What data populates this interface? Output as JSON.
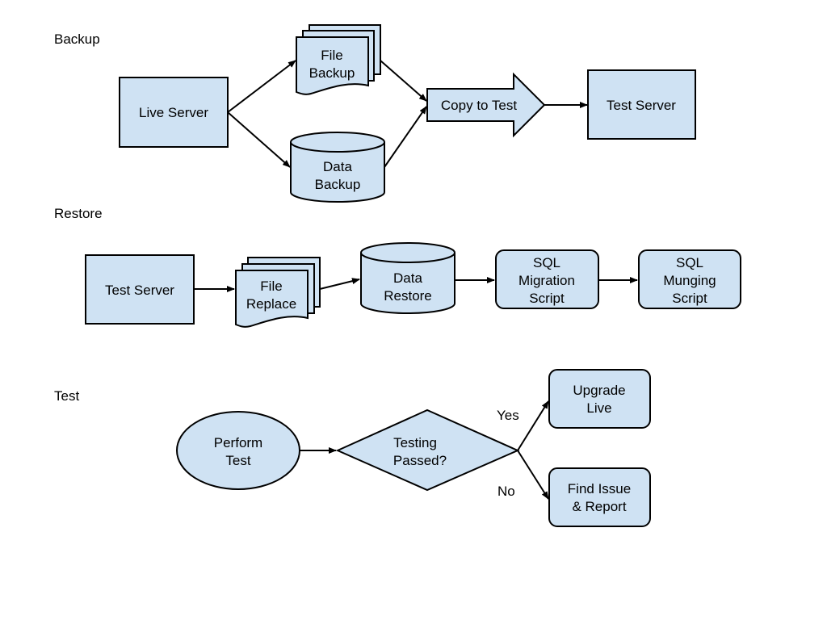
{
  "colors": {
    "fill": "#cfe2f3",
    "stroke": "#000000"
  },
  "sections": {
    "backup": "Backup",
    "restore": "Restore",
    "test": "Test"
  },
  "backup": {
    "live_server": "Live Server",
    "file_backup": [
      "File",
      "Backup"
    ],
    "data_backup": [
      "Data",
      "Backup"
    ],
    "copy_to_test": "Copy to Test",
    "test_server": "Test Server"
  },
  "restore": {
    "test_server": "Test Server",
    "file_replace": [
      "File",
      "Replace"
    ],
    "data_restore": [
      "Data",
      "Restore"
    ],
    "sql_migration": [
      "SQL",
      "Migration",
      "Script"
    ],
    "sql_munging": [
      "SQL",
      "Munging",
      "Script"
    ]
  },
  "test": {
    "perform_test": [
      "Perform",
      "Test"
    ],
    "testing_passed": [
      "Testing",
      "Passed?"
    ],
    "yes": "Yes",
    "no": "No",
    "upgrade_live": [
      "Upgrade",
      "Live"
    ],
    "find_issue": [
      "Find Issue",
      "& Report"
    ]
  }
}
